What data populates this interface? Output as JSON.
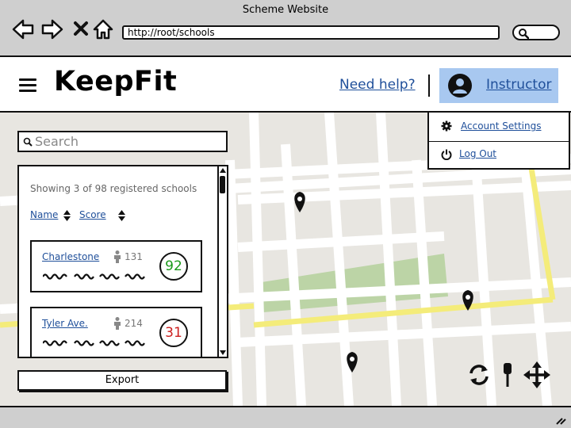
{
  "window": {
    "title": "Scheme Website",
    "url": "http://root/schools"
  },
  "header": {
    "logo": "KeepFit",
    "help_link": "Need help?",
    "user_label": "Instructor"
  },
  "user_menu": {
    "items": [
      {
        "label": "Account Settings",
        "icon": "gear-icon"
      },
      {
        "label": "Log Out",
        "icon": "power-icon"
      }
    ]
  },
  "search": {
    "placeholder": "Search",
    "value": ""
  },
  "list": {
    "summary": "Showing 3 of 98 registered schools",
    "sort_columns": [
      "Name",
      "Score"
    ],
    "schools": [
      {
        "name": "Charlestone",
        "count": "131",
        "score": "92",
        "score_color": "#1a9a1a"
      },
      {
        "name": "Tyler Ave.",
        "count": "214",
        "score": "31",
        "score_color": "#cc1f1f"
      }
    ]
  },
  "export_label": "Export",
  "map_controls": [
    "refresh-icon",
    "pin-drop-icon",
    "move-icon"
  ],
  "colors": {
    "accent": "#a8c8f0",
    "link": "#1f4f9a",
    "road_yellow": "#f4ec7a",
    "park": "#bcd4a6"
  }
}
